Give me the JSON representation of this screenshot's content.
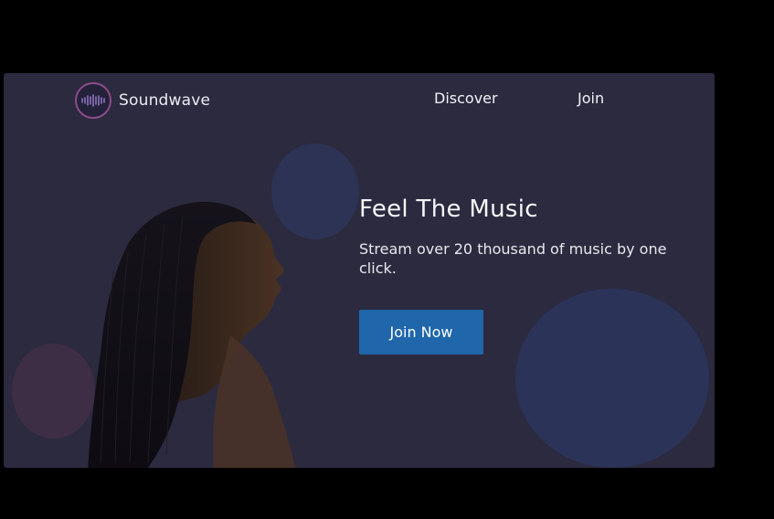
{
  "brand": {
    "name": "Soundwave",
    "icon": "soundwave-logo-icon",
    "ring_color": "#8e4c8a"
  },
  "nav": {
    "items": [
      {
        "label": "Discover"
      },
      {
        "label": "Join"
      }
    ]
  },
  "hero": {
    "title": "Feel The Music",
    "subtitle": "Stream over 20 thousand of music by one click.",
    "cta_label": "Join Now",
    "image": "woman-profile-silhouette"
  },
  "colors": {
    "page_background": "#000000",
    "frame_background": "#2c2a3f",
    "accent_button": "#1f66ab",
    "blob_blue": "#2b3358",
    "blob_purple": "#3d2d45"
  }
}
